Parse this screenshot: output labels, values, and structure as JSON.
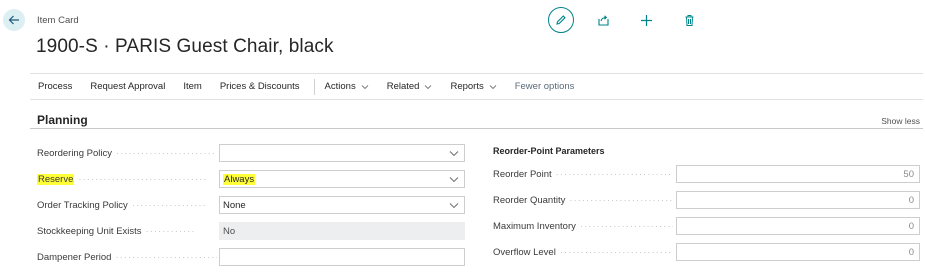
{
  "header": {
    "caption": "Item Card",
    "title": "1900-S · PARIS Guest Chair, black"
  },
  "actions": {
    "items": [
      {
        "label": "Process"
      },
      {
        "label": "Request Approval"
      },
      {
        "label": "Item"
      },
      {
        "label": "Prices & Discounts"
      }
    ],
    "dropdowns": [
      {
        "label": "Actions"
      },
      {
        "label": "Related"
      },
      {
        "label": "Reports"
      }
    ],
    "fewer_options": "Fewer options"
  },
  "section": {
    "title": "Planning",
    "show_less": "Show less"
  },
  "left_fields": [
    {
      "label": "Reordering Policy",
      "value": ""
    },
    {
      "label": "Reserve",
      "value": "Always"
    },
    {
      "label": "Order Tracking Policy",
      "value": "None"
    },
    {
      "label": "Stockkeeping Unit Exists",
      "value": "No"
    },
    {
      "label": "Dampener Period",
      "value": ""
    }
  ],
  "reorder": {
    "heading": "Reorder-Point Parameters",
    "fields": [
      {
        "label": "Reorder Point",
        "value": "50"
      },
      {
        "label": "Reorder Quantity",
        "value": "0"
      },
      {
        "label": "Maximum Inventory",
        "value": "0"
      },
      {
        "label": "Overflow Level",
        "value": "0"
      }
    ]
  },
  "icons": {
    "back": "arrow-left-icon",
    "edit": "pencil-icon",
    "share": "share-icon",
    "new": "plus-icon",
    "delete": "trash-icon",
    "dropdown": "chevron-down-icon"
  },
  "colors": {
    "accent": "#008489",
    "highlight": "#ffff37",
    "readonly_bg": "#eceeef"
  }
}
